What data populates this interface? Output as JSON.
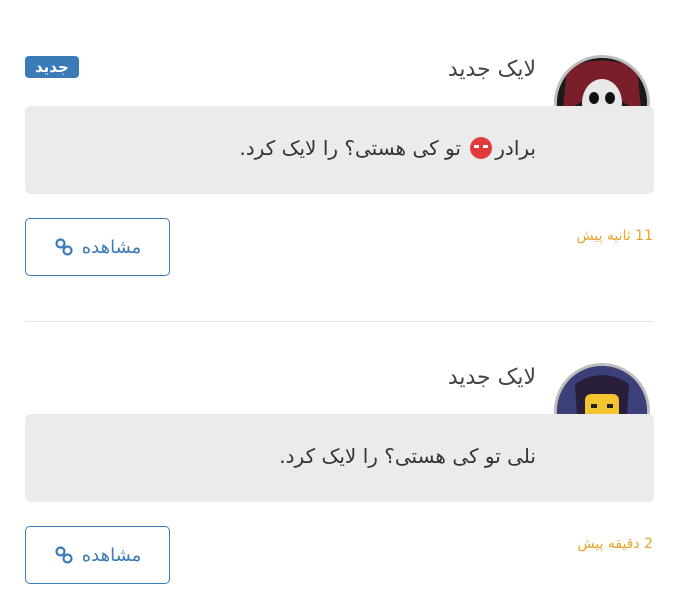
{
  "notifications": [
    {
      "title": "لایک جدید",
      "badge": "جدید",
      "message_prefix": "برادر",
      "message_suffix": " تو کی هستی؟ را لایک کرد.",
      "time": "11 ثانیه پیش",
      "view_label": "مشاهده",
      "avatar_icon": "dark-anime-character-avatar"
    },
    {
      "title": "لایک جدید",
      "message": "نلی تو کی هستی؟ را لایک کرد.",
      "time": "2 دقیقه پیش",
      "view_label": "مشاهده",
      "avatar_icon": "lego-ninja-avatar"
    }
  ],
  "colors": {
    "accent": "#3a7bb8",
    "time": "#e8a52a",
    "message_bg": "#ebebeb"
  },
  "icons": {
    "view": "link-icon",
    "emoji": "red-devil-emoji"
  }
}
